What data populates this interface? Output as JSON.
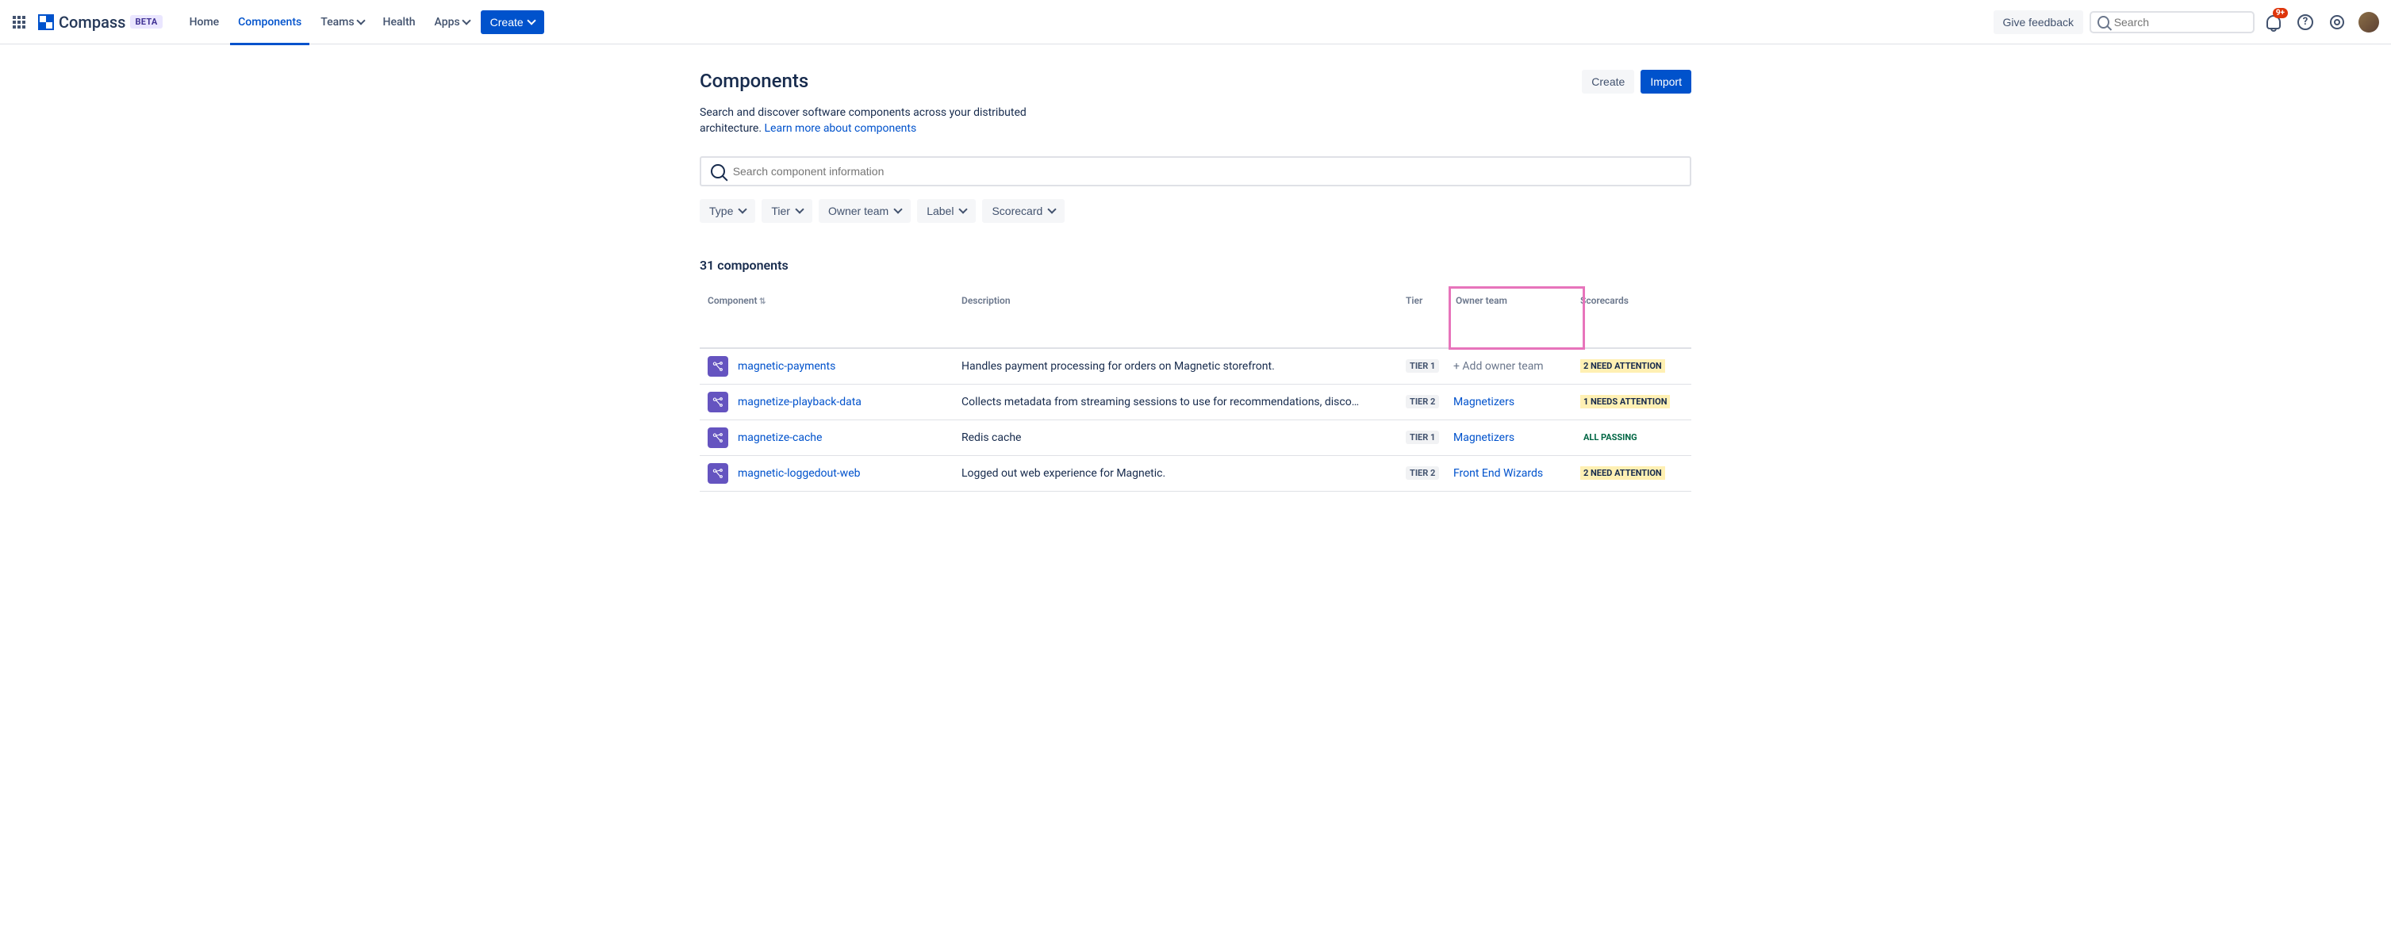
{
  "header": {
    "product": "Compass",
    "beta": "BETA",
    "nav": {
      "home": "Home",
      "components": "Components",
      "teams": "Teams",
      "health": "Health",
      "apps": "Apps"
    },
    "create": "Create",
    "feedback": "Give feedback",
    "search_placeholder": "Search",
    "notification_badge": "9+"
  },
  "page": {
    "title": "Components",
    "subtitle_a": "Search and discover software components across your distributed architecture. ",
    "subtitle_link": "Learn more about components",
    "create": "Create",
    "import": "Import",
    "search_placeholder": "Search component information",
    "filters": {
      "type": "Type",
      "tier": "Tier",
      "owner": "Owner team",
      "label": "Label",
      "scorecard": "Scorecard"
    },
    "count": "31 components"
  },
  "columns": {
    "component": "Component",
    "description": "Description",
    "tier": "Tier",
    "owner": "Owner team",
    "scorecards": "Scorecards"
  },
  "add_owner": "+ Add owner team",
  "rows": [
    {
      "name": "magnetic-payments",
      "desc": "Handles payment processing for orders on Magnetic storefront.",
      "tier": "TIER 1",
      "team": null,
      "score": "2 NEED ATTENTION",
      "score_class": "warn"
    },
    {
      "name": "magnetize-playback-data",
      "desc": "Collects metadata from streaming sessions to use for recommendations, disco…",
      "tier": "TIER 2",
      "team": "Magnetizers",
      "score": "1 NEEDS ATTENTION",
      "score_class": "warn"
    },
    {
      "name": "magnetize-cache",
      "desc": "Redis cache",
      "tier": "TIER 1",
      "team": "Magnetizers",
      "score": "ALL PASSING",
      "score_class": "ok"
    },
    {
      "name": "magnetic-loggedout-web",
      "desc": "Logged out web experience for Magnetic.",
      "tier": "TIER 2",
      "team": "Front End Wizards",
      "score": "2 NEED ATTENTION",
      "score_class": "warn"
    }
  ]
}
